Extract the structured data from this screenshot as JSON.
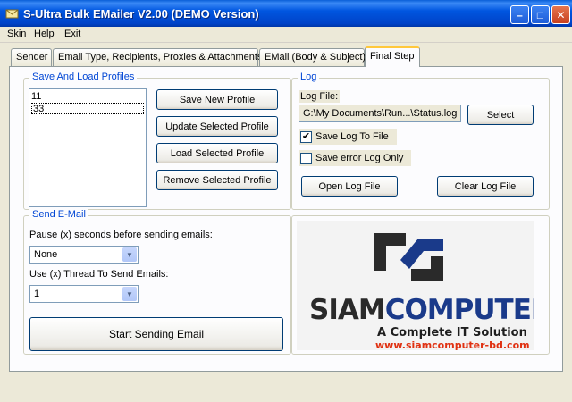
{
  "window": {
    "title": "S-Ultra Bulk EMailer V2.00 (DEMO Version)",
    "minimize_glyph": "–",
    "maximize_glyph": "□",
    "close_glyph": "✕"
  },
  "menu": [
    "Skin",
    "Help",
    "Exit"
  ],
  "tabs": [
    {
      "label": "Sender",
      "active": false
    },
    {
      "label": "Email Type, Recipients, Proxies & Attachments",
      "active": false
    },
    {
      "label": "EMail (Body & Subject)",
      "active": false
    },
    {
      "label": "Final Step",
      "active": true
    }
  ],
  "profiles": {
    "title": "Save And Load Profiles",
    "items": [
      "11",
      "33"
    ],
    "selected_index": 1,
    "buttons": {
      "save_new": "Save New Profile",
      "update": "Update Selected Profile",
      "load": "Load Selected Profile",
      "remove": "Remove Selected Profile"
    }
  },
  "log": {
    "title": "Log",
    "file_label": "Log File:",
    "file_value": "G:\\My Documents\\Run...\\Status.log",
    "select_button": "Select",
    "save_log_label": "Save Log To File",
    "save_log_checked": true,
    "save_error_label": "Save error Log Only",
    "save_error_checked": false,
    "open_button": "Open Log File",
    "clear_button": "Clear Log File"
  },
  "send": {
    "title": "Send E-Mail",
    "pause_label": "Pause (x) seconds before sending emails:",
    "pause_value": "None",
    "thread_label": "Use (x) Thread To Send Emails:",
    "thread_value": "1",
    "start_button": "Start Sending Email"
  },
  "logo": {
    "name_part1": "SIAM",
    "name_part2": "COMPUTER",
    "tagline": "A Complete IT Solution",
    "url": "www.siamcomputer-bd.com",
    "colors": {
      "blue": "#1a3a8a",
      "dark": "#2a2a2a",
      "url": "#e03010"
    }
  },
  "check_glyph": "✔"
}
